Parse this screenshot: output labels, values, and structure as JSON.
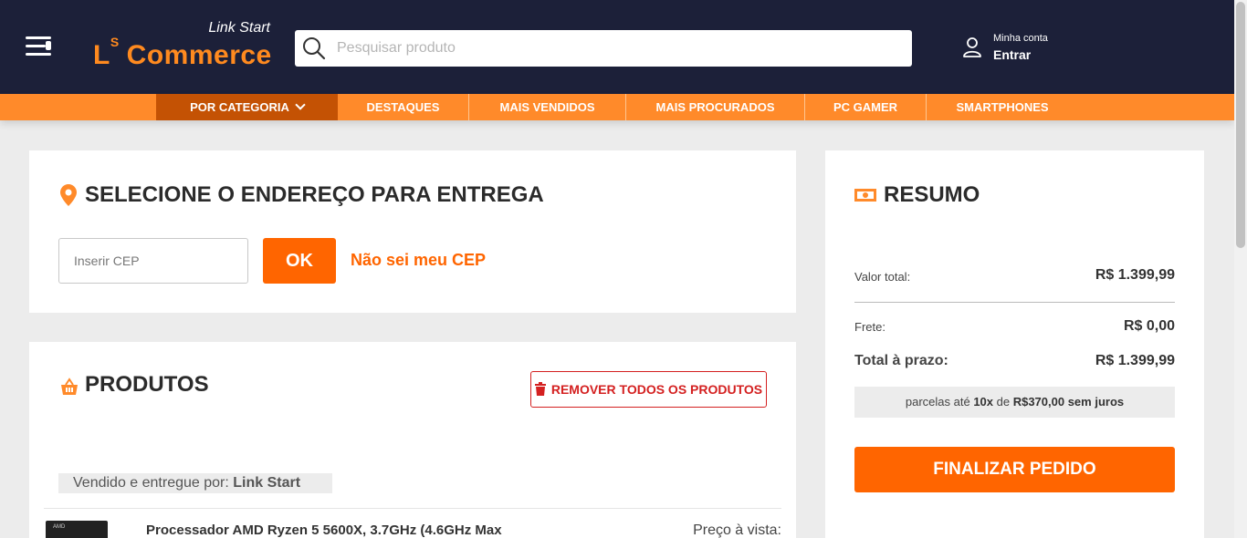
{
  "header": {
    "tagline": "Link Start",
    "brand_prefix": "L",
    "brand_sup": "S",
    "brand_name": "Commerce",
    "search_placeholder": "Pesquisar produto",
    "account_small": "Minha conta",
    "account_big": "Entrar"
  },
  "nav": {
    "category": "POR CATEGORIA",
    "items": [
      "DESTAQUES",
      "MAIS VENDIDOS",
      "MAIS PROCURADOS",
      "PC GAMER",
      "SMARTPHONES"
    ]
  },
  "delivery": {
    "title": "SELECIONE O ENDEREÇO PARA ENTREGA",
    "cep_placeholder": "Inserir CEP",
    "ok_label": "OK",
    "cep_link": "Não sei meu CEP"
  },
  "produtos": {
    "title": "PRODUTOS",
    "remove_all_label": "REMOVER TODOS OS PRODUTOS",
    "seller_prefix": "Vendido e entregue por: ",
    "seller_name": "Link Start",
    "product_thumb_text": "AMD",
    "product_name": "Processador AMD Ryzen 5 5600X, 3.7GHz (4.6GHz Max",
    "price_label": "Preço à vista:"
  },
  "resumo": {
    "title": "RESUMO",
    "valor_total_label": "Valor total:",
    "valor_total": "R$ 1.399,99",
    "frete_label": "Frete:",
    "frete": "R$ 0,00",
    "total_prazo_label": "Total à prazo:",
    "total_prazo": "R$ 1.399,99",
    "installments_prefix": "parcelas até ",
    "installments_count": "10x",
    "installments_mid": " de ",
    "installments_value": "R$370,00 sem juros",
    "finalize_label": "FINALIZAR PEDIDO"
  },
  "colors": {
    "header_bg": "#1c2039",
    "accent": "#ff8a2a",
    "button": "#ff6500",
    "danger": "#d42020"
  }
}
